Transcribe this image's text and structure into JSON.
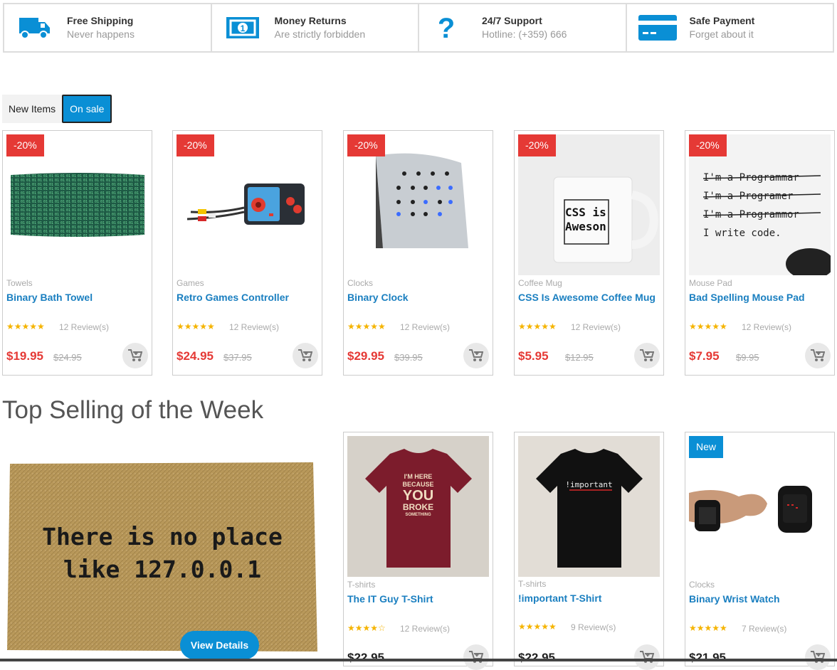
{
  "features": [
    {
      "icon": "truck-icon",
      "title": "Free Shipping",
      "subtitle": "Never happens"
    },
    {
      "icon": "money-icon",
      "title": "Money Returns",
      "subtitle": "Are strictly forbidden"
    },
    {
      "icon": "question-icon",
      "title": "24/7 Support",
      "subtitle": "Hotline: (+359) 666"
    },
    {
      "icon": "credit-card-icon",
      "title": "Safe Payment",
      "subtitle": "Forget about it"
    }
  ],
  "tabs": [
    {
      "label": "New Items",
      "active": false
    },
    {
      "label": "On sale",
      "active": true
    }
  ],
  "sale_products": [
    {
      "badge": "-20%",
      "category": "Towels",
      "name": "Binary Bath Towel",
      "stars": "★★★★★",
      "reviews": "12 Review(s)",
      "price": "$19.95",
      "old_price": "$24.95"
    },
    {
      "badge": "-20%",
      "category": "Games",
      "name": "Retro Games Controller",
      "stars": "★★★★★",
      "reviews": "12 Review(s)",
      "price": "$24.95",
      "old_price": "$37.95"
    },
    {
      "badge": "-20%",
      "category": "Clocks",
      "name": "Binary Clock",
      "stars": "★★★★★",
      "reviews": "12 Review(s)",
      "price": "$29.95",
      "old_price": "$39.95"
    },
    {
      "badge": "-20%",
      "category": "Coffee Mug",
      "name": "CSS Is Awesome Coffee Mug",
      "stars": "★★★★★",
      "reviews": "12 Review(s)",
      "price": "$5.95",
      "old_price": "$12.95",
      "image_text": [
        "CSS is",
        "Aweson"
      ]
    },
    {
      "badge": "-20%",
      "category": "Mouse Pad",
      "name": "Bad Spelling Mouse Pad",
      "stars": "★★★★★",
      "reviews": "12 Review(s)",
      "price": "$7.95",
      "old_price": "$9.95",
      "image_text": [
        "I'm a Programmar",
        "I'm a Programer",
        "I'm a Programmor",
        "I write code."
      ]
    }
  ],
  "top_selling": {
    "title": "Top Selling of the Week",
    "featured_text": [
      "There is no place",
      "like 127.0.0.1"
    ],
    "view_details": "View Details",
    "products": [
      {
        "category": "T-shirts",
        "name": "The IT Guy T-Shirt",
        "stars": "★★★★☆",
        "reviews": "12 Review(s)",
        "price": "$22.95",
        "image_text": [
          "I'M HERE",
          "BECAUSE",
          "YOU",
          "BROKE",
          "SOMETHING"
        ]
      },
      {
        "category": "T-shirts",
        "name": "!important T-Shirt",
        "stars": "★★★★★",
        "reviews": "9 Review(s)",
        "price": "$22.95",
        "image_text": "!important"
      },
      {
        "badge": "New",
        "category": "Clocks",
        "name": "Binary Wrist Watch",
        "stars": "★★★★★",
        "reviews": "7 Review(s)",
        "price": "$21.95"
      }
    ]
  },
  "colors": {
    "accent": "#0a8fd5",
    "sale": "#e53935",
    "stars": "#f5b400"
  }
}
